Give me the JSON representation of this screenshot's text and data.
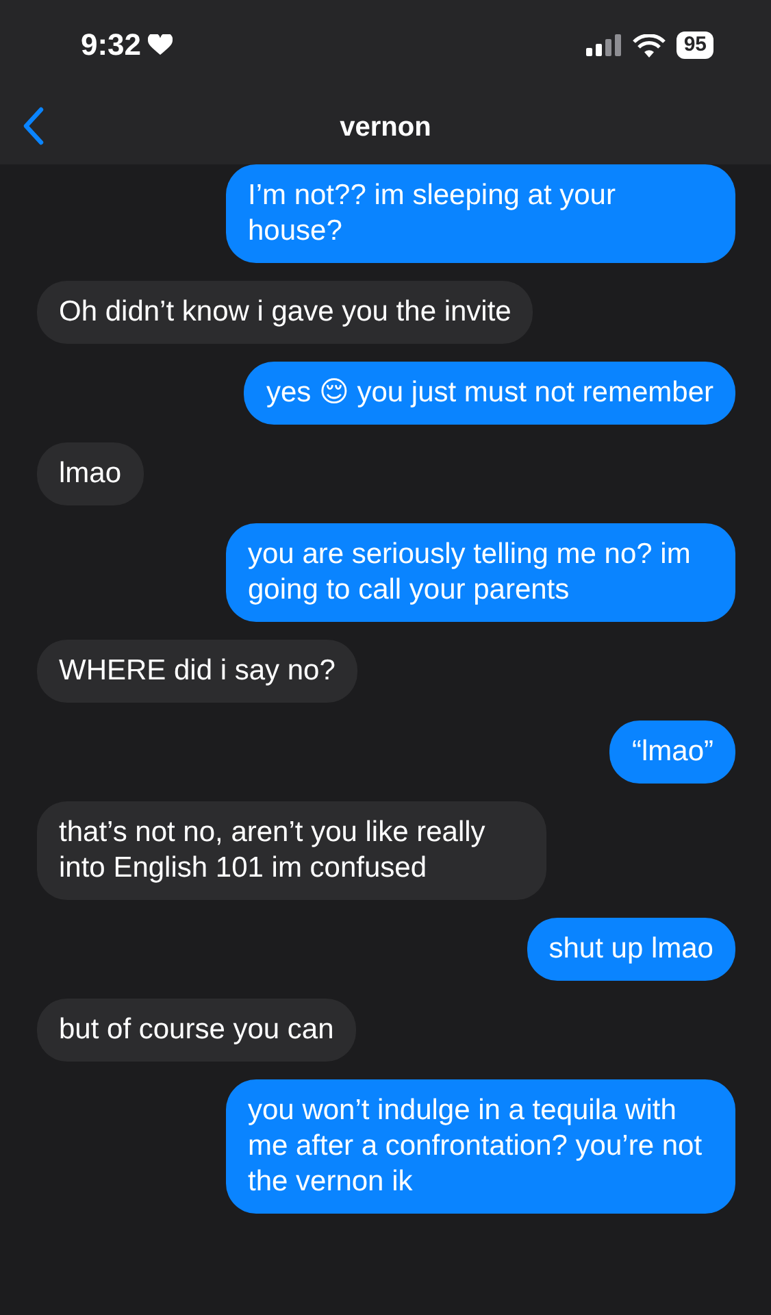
{
  "status_bar": {
    "time": "9:32",
    "battery": "95"
  },
  "header": {
    "title": "vernon"
  },
  "messages": [
    {
      "text": "I’m not?? im sleeping at your house?",
      "sent": true
    },
    {
      "text": "Oh didn’t know i gave you the invite",
      "sent": false
    },
    {
      "text": "yes 😌 you just must not remember",
      "sent": true
    },
    {
      "text": "lmao",
      "sent": false
    },
    {
      "text": "you are seriously telling me no? im going to call your parents",
      "sent": true
    },
    {
      "text": "WHERE did i say no?",
      "sent": false
    },
    {
      "text": "“lmao”",
      "sent": true
    },
    {
      "text": "that’s not no, aren’t you like really into English 101 im confused",
      "sent": false
    },
    {
      "text": "shut up lmao",
      "sent": true
    },
    {
      "text": "but of course you can",
      "sent": false
    },
    {
      "text": "you won’t indulge in a tequila with me after a confrontation? you’re not the vernon ik",
      "sent": true
    }
  ]
}
